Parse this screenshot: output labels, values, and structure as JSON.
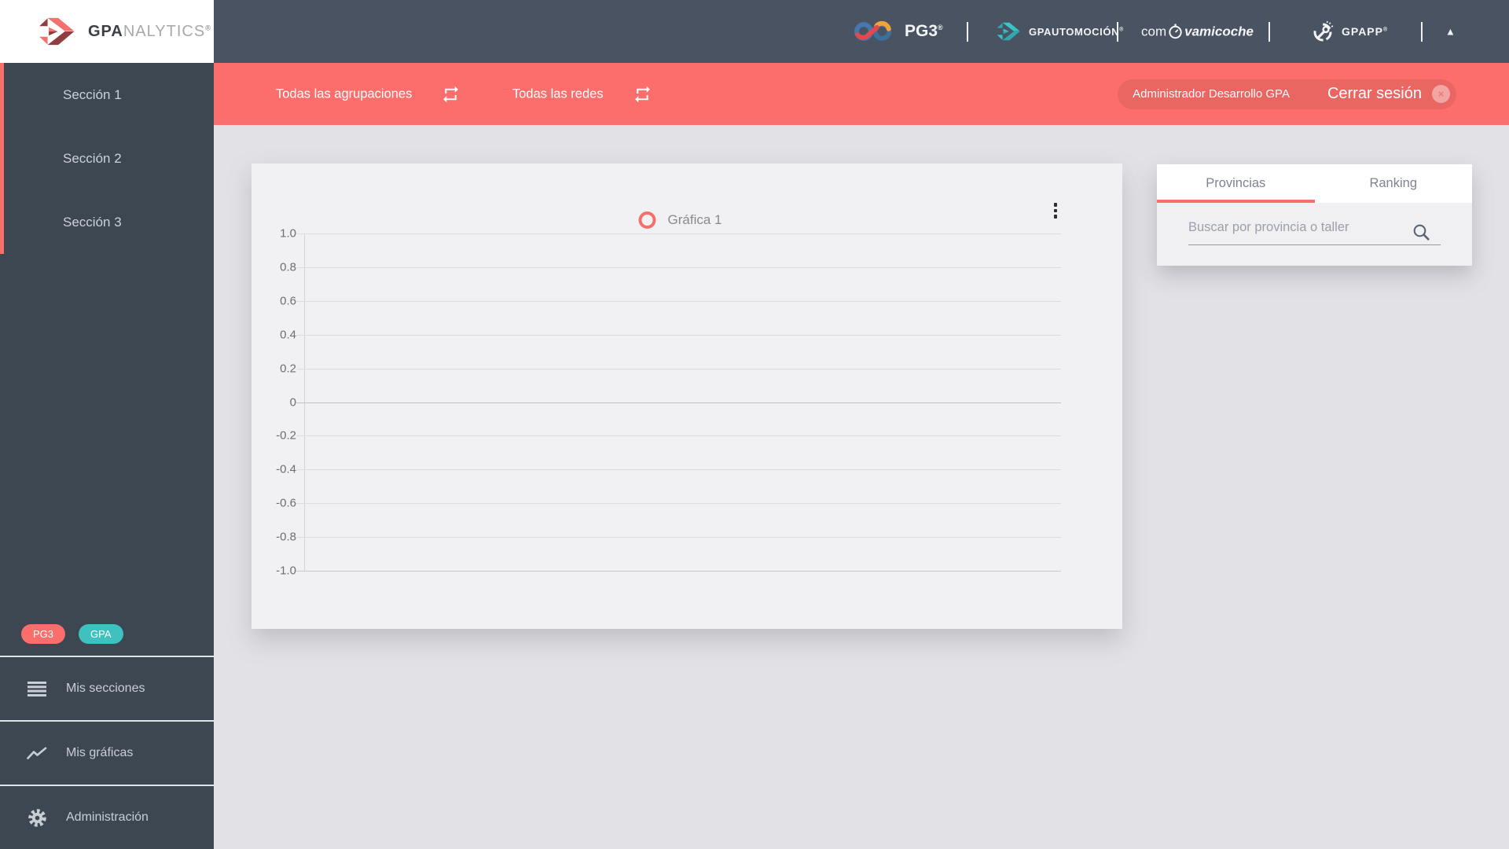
{
  "colors": {
    "accent_red": "#fb6e6b",
    "accent_teal": "#3fc1bf",
    "header_dark": "#4a5362",
    "sidebar_dark": "#3d4752"
  },
  "sidebar": {
    "logo": {
      "bold": "GPA",
      "light": "NALYTICS",
      "registered": "®"
    },
    "sections": [
      {
        "label": "Sección 1"
      },
      {
        "label": "Sección 2"
      },
      {
        "label": "Sección 3"
      }
    ],
    "badges": [
      {
        "label": "PG3"
      },
      {
        "label": "GPA"
      }
    ],
    "menu": [
      {
        "label": "Mis secciones",
        "icon": "list-icon"
      },
      {
        "label": "Mis gráficas",
        "icon": "line-chart-icon"
      },
      {
        "label": "Administración",
        "icon": "gear-icon"
      }
    ]
  },
  "header": {
    "pg3": {
      "text": "PG3",
      "registered": "®"
    },
    "gpautomocion": {
      "text": "GPAUTOMOCIÓN",
      "registered": "®"
    },
    "comvamicoche": {
      "left": "com",
      "right": "vamicoche"
    },
    "gpapp": {
      "text": "GPAPP",
      "registered": "®"
    },
    "collapse_icon": "▲"
  },
  "filter_bar": {
    "filters": [
      {
        "label": "Todas las agrupaciones",
        "icon": "repeat-icon"
      },
      {
        "label": "Todas las redes",
        "icon": "repeat-icon"
      }
    ],
    "user_name": "Administrador Desarrollo GPA",
    "logout_label": "Cerrar sesión",
    "logout_icon": "×"
  },
  "panel": {
    "tabs": [
      {
        "label": "Provincias",
        "active": true
      },
      {
        "label": "Ranking",
        "active": false
      }
    ],
    "search_placeholder": "Buscar por provincia o taller"
  },
  "chart_data": {
    "type": "line",
    "title": "",
    "legend": [
      "Gráfica 1"
    ],
    "legend_position": "top",
    "series": [
      {
        "name": "Gráfica 1",
        "x": [],
        "values": []
      }
    ],
    "categories": [],
    "ylim": [
      -1.0,
      1.0
    ],
    "y_tick_labels": [
      "1.0",
      "0.8",
      "0.6",
      "0.4",
      "0.2",
      "0",
      "-0.2",
      "-0.4",
      "-0.6",
      "-0.8",
      "-1.0"
    ],
    "grid": true
  }
}
